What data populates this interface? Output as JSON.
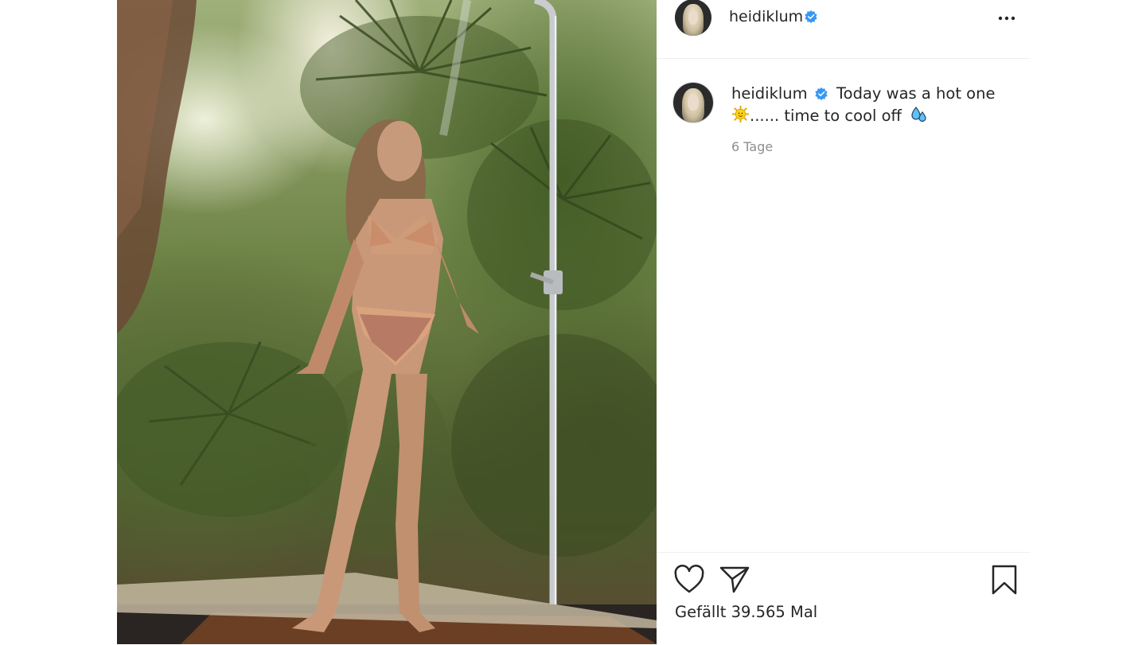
{
  "post": {
    "image_alt": "",
    "header": {
      "username": "heidiklum",
      "verified_icon": "verified-badge-icon",
      "more_icon": "more-options-icon"
    },
    "caption": {
      "username": "heidiklum",
      "text_part1": "Today was a hot one",
      "emoji_sun": "sun-emoji-icon",
      "text_part2": "...... time to cool off",
      "emoji_droplets": "sweat-droplets-emoji-icon"
    },
    "timestamp": "6 Tage",
    "actions": {
      "like_icon": "heart-icon",
      "share_icon": "paper-plane-icon",
      "save_icon": "bookmark-icon"
    },
    "likes_text": "Gefällt 39.565 Mal"
  },
  "colors": {
    "verified": "#3897f0",
    "text": "#262626",
    "muted": "#8e8e8e",
    "divider": "#efefef"
  }
}
